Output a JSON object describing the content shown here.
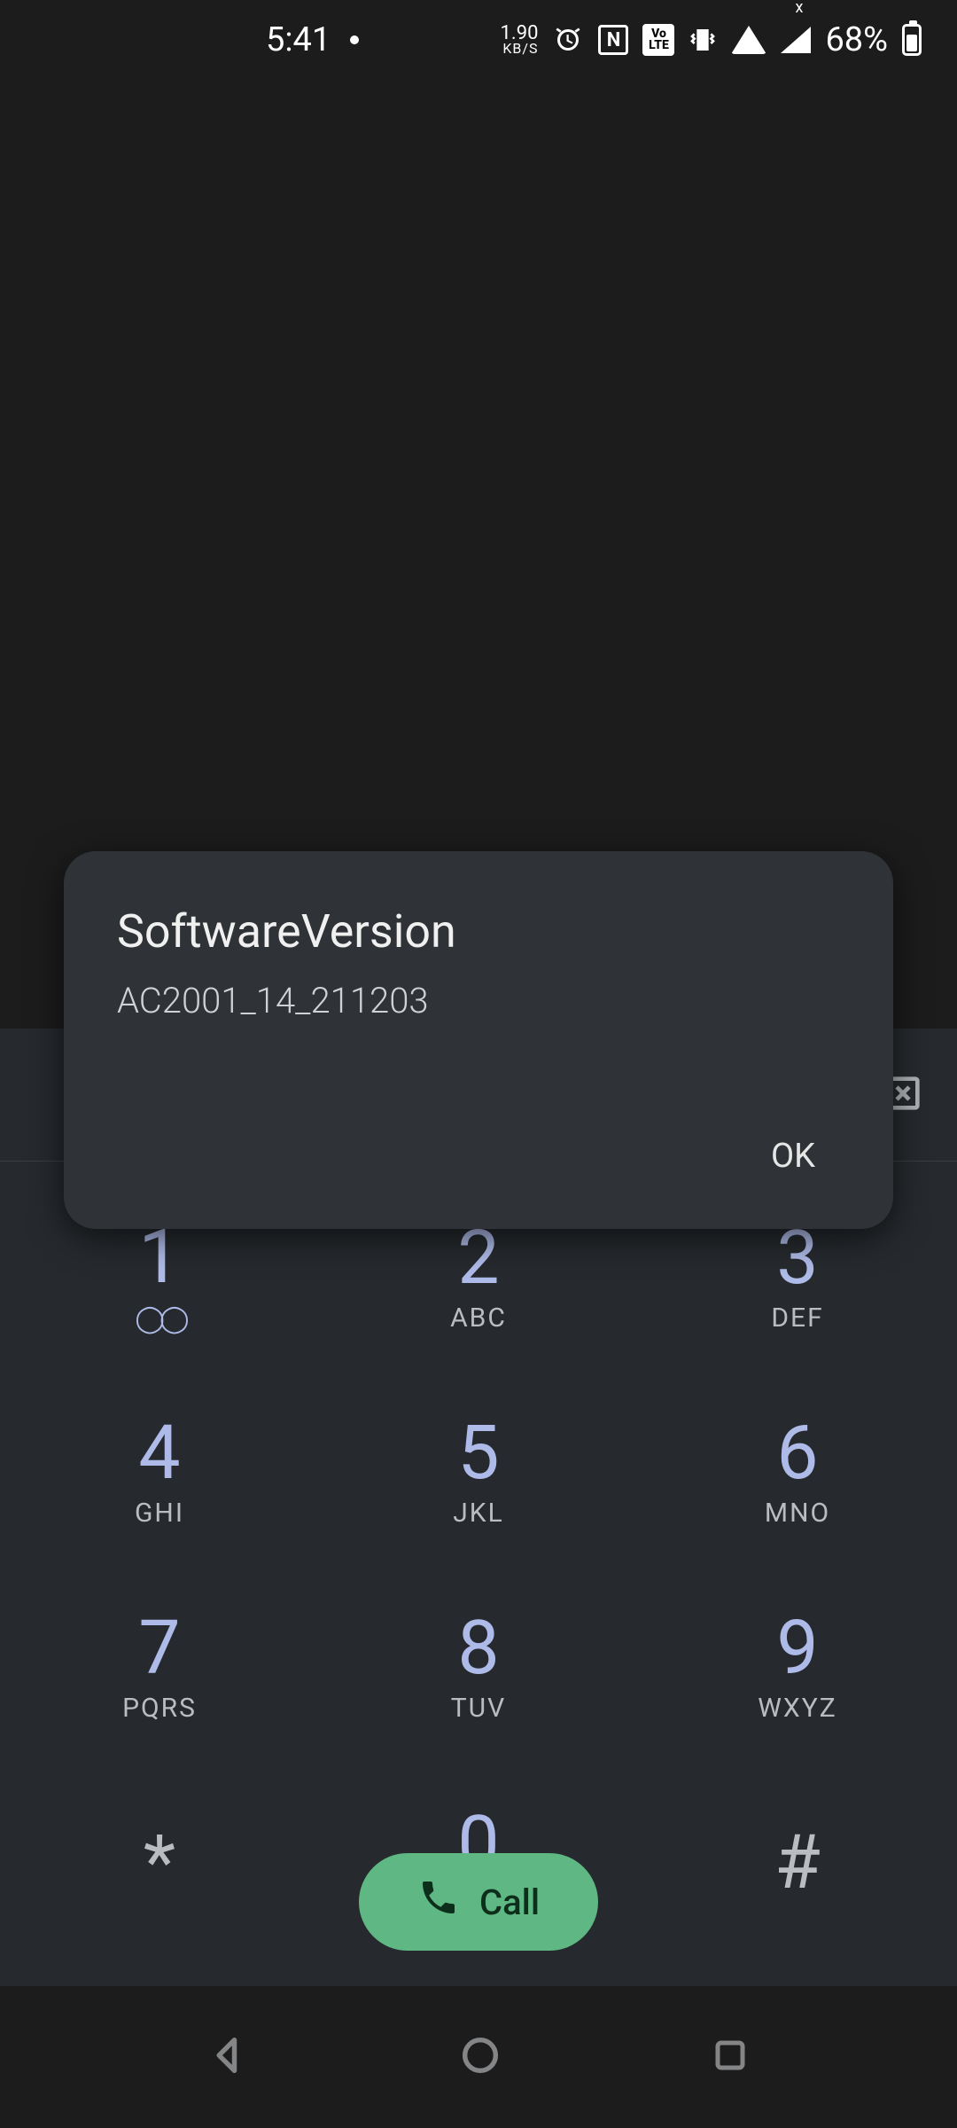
{
  "status": {
    "time": "5:41",
    "net_speed_value": "1.90",
    "net_speed_unit": "KB/S",
    "battery_pct": "68%"
  },
  "dialog": {
    "title": "SoftwareVersion",
    "body": "AC2001_14_211203",
    "ok_label": "OK"
  },
  "keypad": {
    "keys": [
      {
        "digit": "1",
        "letters": ""
      },
      {
        "digit": "2",
        "letters": "ABC"
      },
      {
        "digit": "3",
        "letters": "DEF"
      },
      {
        "digit": "4",
        "letters": "GHI"
      },
      {
        "digit": "5",
        "letters": "JKL"
      },
      {
        "digit": "6",
        "letters": "MNO"
      },
      {
        "digit": "7",
        "letters": "PQRS"
      },
      {
        "digit": "8",
        "letters": "TUV"
      },
      {
        "digit": "9",
        "letters": "WXYZ"
      },
      {
        "digit": "*",
        "letters": ""
      },
      {
        "digit": "0",
        "letters": "+"
      },
      {
        "digit": "#",
        "letters": ""
      }
    ],
    "call_label": "Call"
  }
}
